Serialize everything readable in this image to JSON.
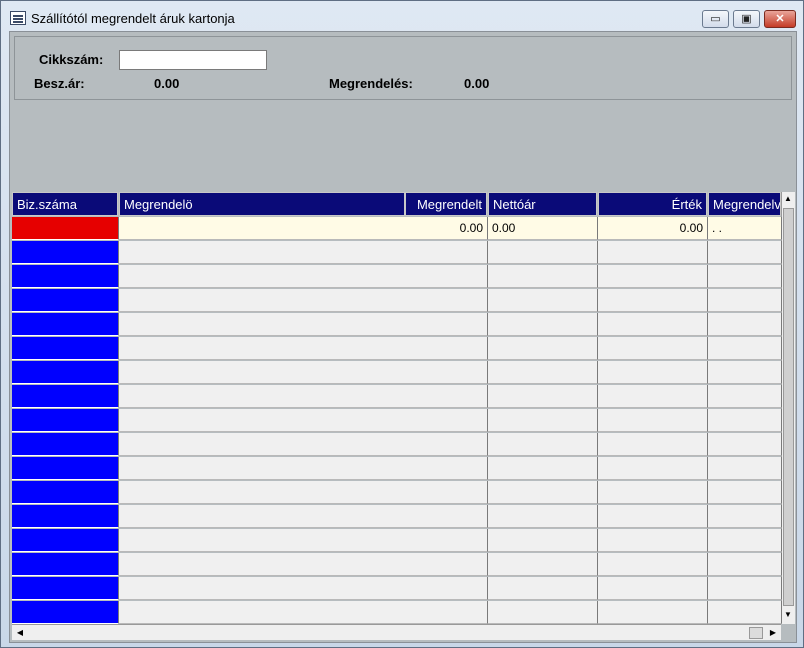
{
  "window": {
    "title": "Szállítótól megrendelt áruk kartonja",
    "min_glyph": "▭",
    "max_glyph": "▣",
    "close_glyph": "✕"
  },
  "form": {
    "cikkszam_label": "Cikkszám:",
    "cikkszam_value": "",
    "beszar_label": "Besz.ár:",
    "beszar_value": "0.00",
    "megrendeles_label": "Megrendelés:",
    "megrendeles_value": "0.00"
  },
  "grid": {
    "columns": [
      {
        "label": "Biz.száma",
        "align": "left"
      },
      {
        "label": "Megrendelö",
        "align": "left"
      },
      {
        "label": "Megrendelt",
        "align": "right"
      },
      {
        "label": "Nettóár",
        "align": "left"
      },
      {
        "label": "Érték",
        "align": "right"
      },
      {
        "label": "Megrendelve",
        "align": "left"
      }
    ],
    "first_row": [
      "",
      "",
      "0.00",
      "0.00",
      "0.00",
      ". ."
    ],
    "empty_row_count": 16
  },
  "colors": {
    "header_bg": "#0a0a78",
    "selected_row_marker": "#e60000",
    "row_marker": "#0000ff",
    "selected_row_bg": "#fffbe6",
    "row_bg": "#f0f0f0"
  },
  "scroll": {
    "up_icon": "▲",
    "down_icon": "▼",
    "left_icon": "◀",
    "right_icon": "▶"
  }
}
